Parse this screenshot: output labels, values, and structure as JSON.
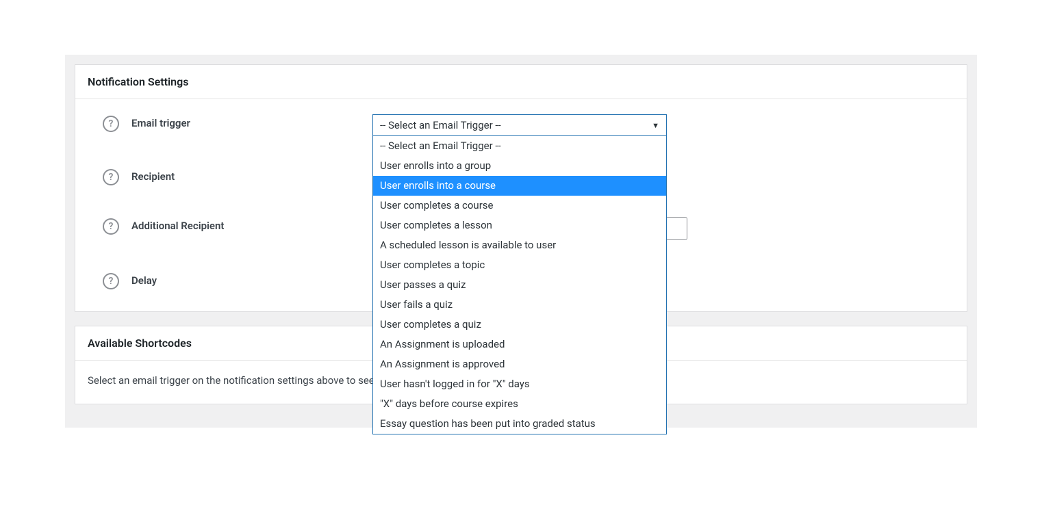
{
  "panels": {
    "settings": {
      "title": "Notification Settings",
      "rows": {
        "email_trigger": {
          "label": "Email trigger"
        },
        "recipient": {
          "label": "Recipient"
        },
        "additional_recipient": {
          "label": "Additional Recipient"
        },
        "delay": {
          "label": "Delay"
        }
      }
    },
    "shortcodes": {
      "title": "Available Shortcodes",
      "empty_message": "Select an email trigger on the notification settings above to see available shortcodes."
    }
  },
  "email_trigger_select": {
    "selected_display": "-- Select an Email Trigger --",
    "options": [
      {
        "label": "-- Select an Email Trigger --",
        "highlighted": false
      },
      {
        "label": "User enrolls into a group",
        "highlighted": false
      },
      {
        "label": "User enrolls into a course",
        "highlighted": true
      },
      {
        "label": "User completes a course",
        "highlighted": false
      },
      {
        "label": "User completes a lesson",
        "highlighted": false
      },
      {
        "label": "A scheduled lesson is available to user",
        "highlighted": false
      },
      {
        "label": "User completes a topic",
        "highlighted": false
      },
      {
        "label": "User passes a quiz",
        "highlighted": false
      },
      {
        "label": "User fails a quiz",
        "highlighted": false
      },
      {
        "label": "User completes a quiz",
        "highlighted": false
      },
      {
        "label": "An Assignment is uploaded",
        "highlighted": false
      },
      {
        "label": "An Assignment is approved",
        "highlighted": false
      },
      {
        "label": "User hasn't logged in for \"X\" days",
        "highlighted": false
      },
      {
        "label": "\"X\" days before course expires",
        "highlighted": false
      },
      {
        "label": "Essay question has been put into graded status",
        "highlighted": false
      }
    ]
  },
  "help_glyph": "?"
}
